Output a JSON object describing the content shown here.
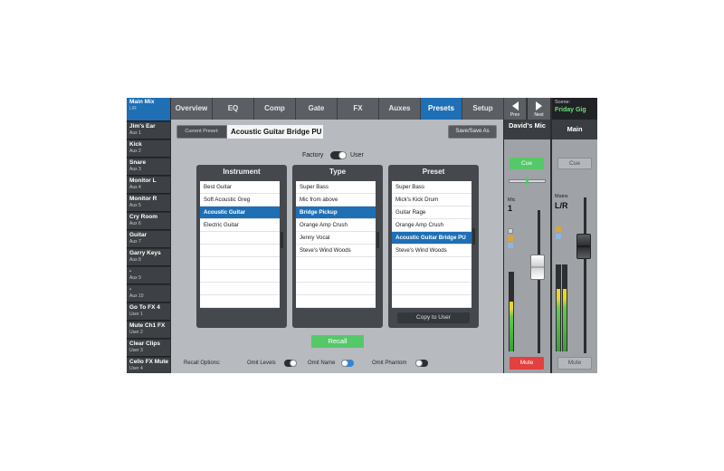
{
  "mix_list": [
    {
      "name": "Main Mix",
      "sub": "L/R",
      "active": true
    },
    {
      "name": "Jim's Ear",
      "sub": "Aux 1"
    },
    {
      "name": "Kick",
      "sub": "Aux 2"
    },
    {
      "name": "Snare",
      "sub": "Aux 3"
    },
    {
      "name": "Monitor L",
      "sub": "Aux 4"
    },
    {
      "name": "Monitor R",
      "sub": "Aux 5"
    },
    {
      "name": "Cry Room",
      "sub": "Aux 6"
    },
    {
      "name": "Guitar",
      "sub": "Aux 7"
    },
    {
      "name": "Garry Keys",
      "sub": "Aux 8"
    },
    {
      "name": "-",
      "sub": "Aux 9"
    },
    {
      "name": "-",
      "sub": "Aux 10"
    },
    {
      "name": "Go To FX 4",
      "sub": "User 1"
    },
    {
      "name": "Mute Ch1 FX",
      "sub": "User 2"
    },
    {
      "name": "Clear Clips",
      "sub": "User 3"
    },
    {
      "name": "Cello FX Mute",
      "sub": "User 4"
    }
  ],
  "tabs": [
    {
      "label": "Overview"
    },
    {
      "label": "EQ"
    },
    {
      "label": "Comp"
    },
    {
      "label": "Gate"
    },
    {
      "label": "FX"
    },
    {
      "label": "Auxes"
    },
    {
      "label": "Presets",
      "active": true
    },
    {
      "label": "Setup"
    }
  ],
  "nav": {
    "prev": "Prev",
    "next": "Next"
  },
  "scene": {
    "label": "Scene:",
    "value": "Friday Gig"
  },
  "presets": {
    "current_label": "Current Preset:",
    "current_value": "Acoustic Guitar Bridge PU",
    "save_label": "Save/Save As",
    "factory_label": "Factory",
    "user_label": "User",
    "instrument": {
      "header": "Instrument",
      "items": [
        "Best Guitar",
        "Soft Acoustic Greg",
        "Acoustic Guitar",
        "Electric Guitar"
      ],
      "selected": 2
    },
    "type": {
      "header": "Type",
      "items": [
        "Super Bass",
        "Mic from above",
        "Bridge Pickup",
        "Orange Amp Crush",
        "Jenny Vocal",
        "Steve's Wind Woods"
      ],
      "selected": 2
    },
    "preset": {
      "header": "Preset",
      "items": [
        "Super Bass",
        "Mick's Kick Drum",
        "Guitar Rage",
        "Orange Amp Crush",
        "Acoustic Guitar Bridge PU",
        "Steve's Wind Woods"
      ],
      "selected": 4
    },
    "copy_label": "Copy to User",
    "recall_label": "Recall",
    "recall_options_label": "Recall Options:",
    "omit_levels": "Omit Levels",
    "omit_name": "Omit Name",
    "omit_phantom": "Omit Phantom"
  },
  "strip_mic": {
    "title": "David's Mic",
    "cue": "Cue",
    "label": "Mic",
    "number": "1",
    "mute": "Mute",
    "level": 0.62
  },
  "strip_main": {
    "title": "Main",
    "cue": "Cue",
    "label": "Mains",
    "number": "L/R",
    "mute": "Mute",
    "level": 0.72
  },
  "colors": {
    "accent": "#1f6fb5",
    "green": "#55c86a",
    "red": "#e34040"
  }
}
